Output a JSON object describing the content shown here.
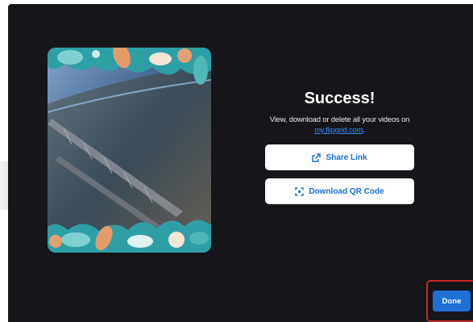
{
  "dialog": {
    "title": "Success!",
    "subtitle_text": "View, download or delete all your videos on",
    "subtitle_link": "my.flipgrid.com",
    "subtitle_end": "."
  },
  "buttons": {
    "share_label": "Share Link",
    "qr_label": "Download QR Code",
    "done_label": "Done"
  },
  "icons": {
    "share": "external-link-icon",
    "qr": "qr-code-icon"
  },
  "colors": {
    "modal_bg": "#16161a",
    "accent": "#1f6fd6",
    "link": "#2d8cff",
    "highlight": "#c62828"
  }
}
